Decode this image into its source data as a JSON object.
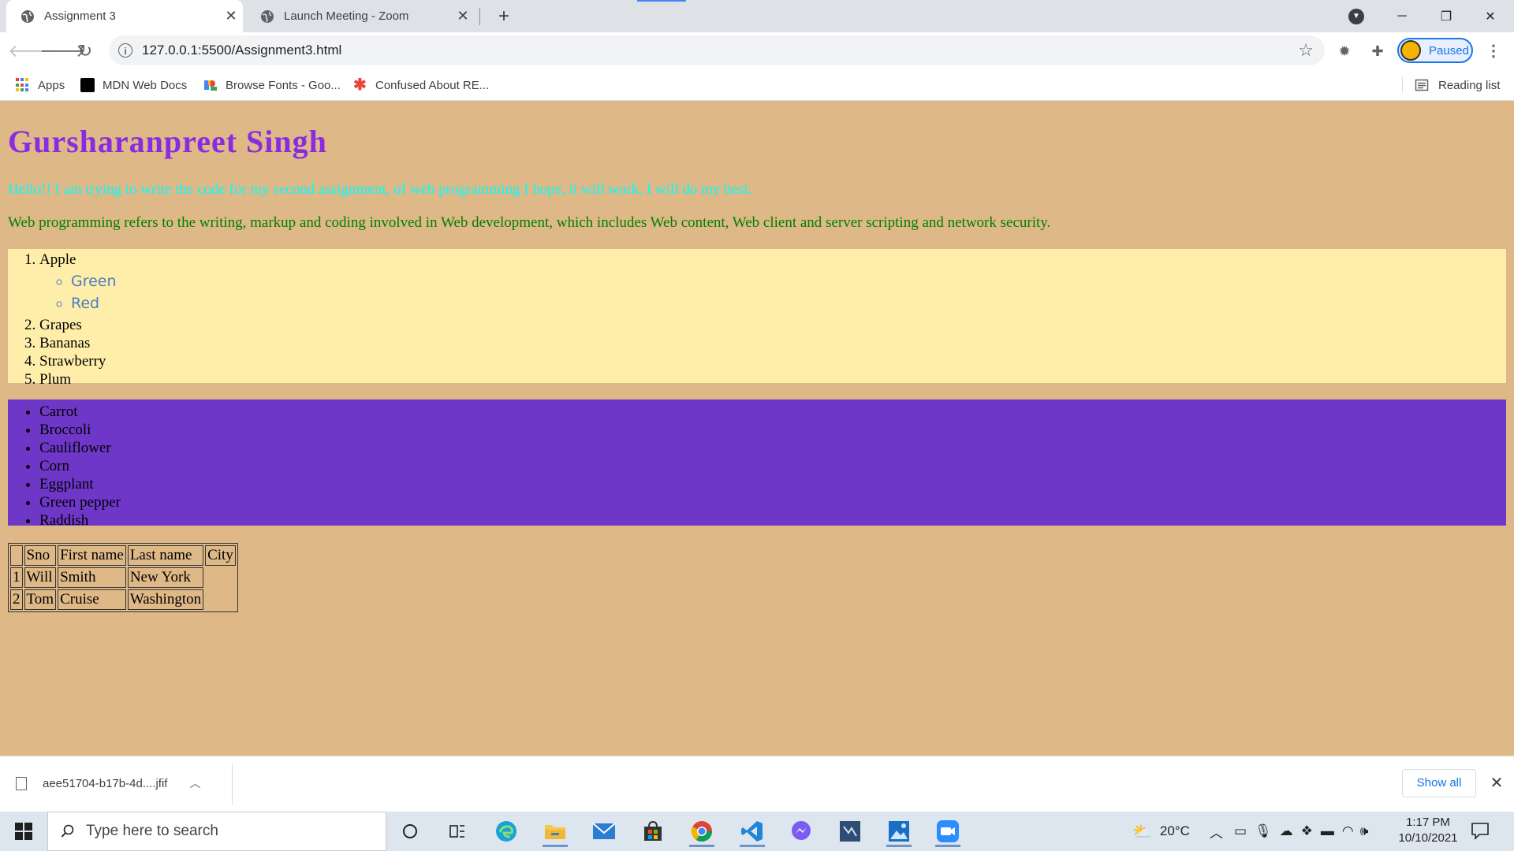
{
  "browser": {
    "tabs": [
      {
        "title": "Assignment 3",
        "close": "✕",
        "active": true
      },
      {
        "title": "Launch Meeting - Zoom",
        "close": "✕",
        "active": false
      }
    ],
    "new_tab": "+",
    "window_controls": {
      "minimize": "─",
      "maximize": "❐",
      "close": "✕"
    },
    "address": "127.0.0.1:5500/Assignment3.html",
    "profile_label": "Paused",
    "bookmarks": [
      {
        "label": "Apps",
        "icon": "apps-grid-icon"
      },
      {
        "label": "MDN Web Docs",
        "icon": "mdn-icon"
      },
      {
        "label": "Browse Fonts - Goo...",
        "icon": "google-fonts-icon"
      },
      {
        "label": "Confused About RE...",
        "icon": "asterisk-icon"
      }
    ],
    "reading_list": "Reading list"
  },
  "page": {
    "heading": "Gursharanpreet Singh",
    "para1": "Hello!! I am trying to write the code for my second assignment, of web programming I hope, it will work. I will do my best.",
    "para2": "Web programming refers to the writing, markup and coding involved in Web development, which includes Web content, Web client and server scripting and network security.",
    "fruits": [
      "Apple",
      "Grapes",
      "Bananas",
      "Strawberry",
      "Plum"
    ],
    "apple_varieties": [
      "Green",
      "Red"
    ],
    "vegetables": [
      "Carrot",
      "Broccoli",
      "Cauliflower",
      "Corn",
      "Eggplant",
      "Green pepper",
      "Raddish"
    ],
    "table": {
      "headers": [
        "",
        "Sno",
        "First name",
        "Last name",
        "City"
      ],
      "rows": [
        [
          "1",
          "Will",
          "Smith",
          "New York"
        ],
        [
          "2",
          "Tom",
          "Cruise",
          "Washington"
        ]
      ]
    },
    "colors": {
      "background": "#deb887",
      "heading": "#8a2be2",
      "para1": "#00ffff",
      "para2": "#008000",
      "ordered_list_bg": "#ffeeaa",
      "unordered_list_bg": "#6e37c8"
    }
  },
  "downloads": {
    "file_name": "aee51704-b17b-4d....jfif",
    "show_all": "Show all"
  },
  "taskbar": {
    "search_placeholder": "Type here to search",
    "weather": "20°C",
    "time": "1:17 PM",
    "date": "10/10/2021"
  }
}
